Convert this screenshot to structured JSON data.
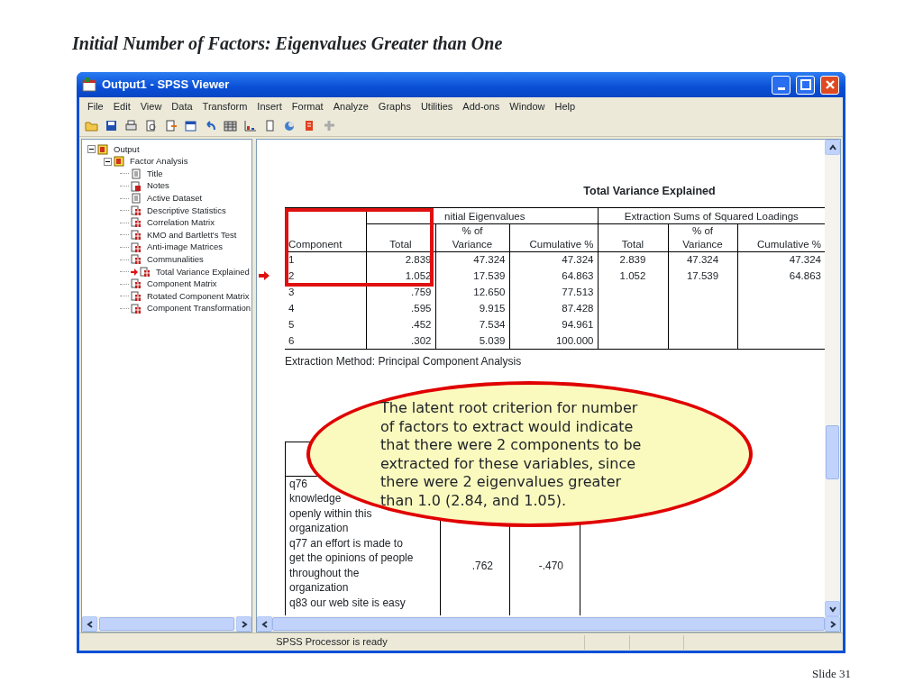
{
  "slide_title": "Initial Number of Factors: Eigenvalues Greater than One",
  "window": {
    "title": "Output1 - SPSS Viewer"
  },
  "menu": [
    "File",
    "Edit",
    "View",
    "Data",
    "Transform",
    "Insert",
    "Format",
    "Analyze",
    "Graphs",
    "Utilities",
    "Add-ons",
    "Window",
    "Help"
  ],
  "tree": [
    {
      "label": "Output",
      "kind": "folder",
      "expanded": true,
      "current": false,
      "children": [
        {
          "label": "Factor Analysis",
          "kind": "folder",
          "expanded": true,
          "current": false,
          "children": [
            {
              "label": "Title",
              "kind": "text",
              "current": false
            },
            {
              "label": "Notes",
              "kind": "notes",
              "current": false
            },
            {
              "label": "Active Dataset",
              "kind": "text",
              "current": false
            },
            {
              "label": "Descriptive Statistics",
              "kind": "table",
              "current": false
            },
            {
              "label": "Correlation Matrix",
              "kind": "table",
              "current": false
            },
            {
              "label": "KMO and Bartlett's Test",
              "kind": "table",
              "current": false
            },
            {
              "label": "Anti-image Matrices",
              "kind": "table",
              "current": false
            },
            {
              "label": "Communalities",
              "kind": "table",
              "current": false
            },
            {
              "label": "Total Variance Explained",
              "kind": "table",
              "current": true
            },
            {
              "label": "Component Matrix",
              "kind": "table",
              "current": false
            },
            {
              "label": "Rotated Component Matrix",
              "kind": "table",
              "current": false
            },
            {
              "label": "Component Transformation",
              "kind": "table",
              "current": false
            }
          ]
        }
      ]
    }
  ],
  "variance_table": {
    "title": "Total Variance Explained",
    "groups": [
      "nitial Eigenvalues",
      "Extraction Sums of Squared Loadings"
    ],
    "columns": [
      "Component",
      "Total",
      "% of Variance",
      "Cumulative %",
      "Total",
      "% of Variance",
      "Cumulative %"
    ],
    "rows": [
      [
        "1",
        "2.839",
        "47.324",
        "47.324",
        "2.839",
        "47.324",
        "47.324"
      ],
      [
        "2",
        "1.052",
        "17.539",
        "64.863",
        "1.052",
        "17.539",
        "64.863"
      ],
      [
        "3",
        ".759",
        "12.650",
        "77.513"
      ],
      [
        "4",
        ".595",
        "9.915",
        "87.428"
      ],
      [
        "5",
        ".452",
        "7.534",
        "94.961"
      ],
      [
        "6",
        ".302",
        "5.039",
        "100.000"
      ]
    ],
    "note": "Extraction Method: Principal Component Analysis"
  },
  "matrix_table": {
    "rows": [
      {
        "lines": [
          "q76",
          "knowledge",
          "openly within this",
          "organization"
        ],
        "values": []
      },
      {
        "lines": [
          "q77  an effort is made to",
          "get the opinions of people",
          "throughout the",
          "organization"
        ],
        "values": [
          ".762",
          "-.470"
        ]
      },
      {
        "lines": [
          "q83  our web site is easy"
        ],
        "values": []
      }
    ]
  },
  "callout": "The latent root criterion for number of factors to extract would indicate that there were 2 components to be extracted for these variables, since there were 2 eigenvalues greater than 1.0 (2.84, and 1.05).",
  "status_bar": "SPSS Processor is ready",
  "slide_number": "Slide 31"
}
